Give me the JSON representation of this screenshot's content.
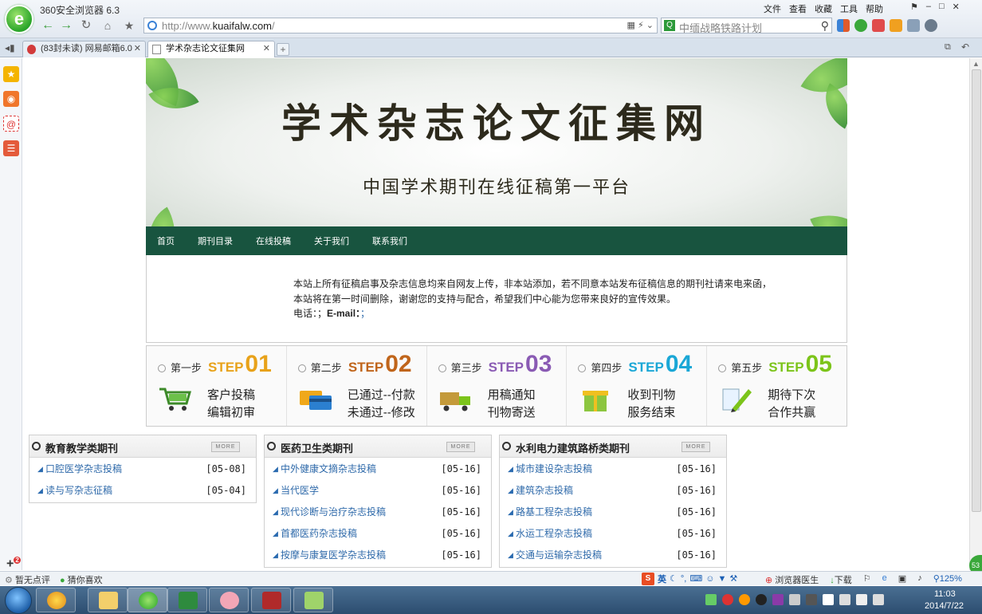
{
  "browser": {
    "title": "360安全浏览器 6.3",
    "url_prefix": "http://www.",
    "url_domain": "kuaifalw.com",
    "url_suffix": "/",
    "search_placeholder": "中缅战略铁路计划",
    "search_engine_icon": "search-engine-icon",
    "menu": [
      "文件",
      "查看",
      "收藏",
      "工具",
      "帮助"
    ],
    "address_tools": "▦ ⚡ ⌄"
  },
  "tabs": [
    {
      "label": "(83封未读) 网易邮箱6.0",
      "icon": "mail-icon",
      "active": false
    },
    {
      "label": "学术杂志论文征集网",
      "icon": "page-icon",
      "active": true
    }
  ],
  "banner": {
    "title": "学术杂志论文征集网",
    "subtitle": "中国学术期刊在线征稿第一平台"
  },
  "nav": [
    "首页",
    "期刊目录",
    "在线投稿",
    "关于我们",
    "联系我们"
  ],
  "notice": {
    "text": "本站上所有征稿启事及杂志信息均来自网友上传，非本站添加，若不同意本站发布征稿信息的期刊社请来电来函，本站将在第一时间删除，谢谢您的支持与配合，希望我们中心能为您带来良好的宣传效果。",
    "phone_label": "电话：；",
    "email_label": "E-mail：",
    "email_value": "；"
  },
  "steps": [
    {
      "label": "第一步",
      "word": "STEP",
      "num": "01",
      "line1": "客户投稿",
      "line2": "编辑初审",
      "color": "#e8a21a",
      "icon": "cart-icon"
    },
    {
      "label": "第二步",
      "word": "STEP",
      "num": "02",
      "line1": "已通过--付款",
      "line2": "未通过--修改",
      "color": "#c0651b",
      "icon": "card-icon"
    },
    {
      "label": "第三步",
      "word": "STEP",
      "num": "03",
      "line1": "用稿通知",
      "line2": "刊物寄送",
      "color": "#8a5bb4",
      "icon": "truck-icon"
    },
    {
      "label": "第四步",
      "word": "STEP",
      "num": "04",
      "line1": "收到刊物",
      "line2": "服务结束",
      "color": "#1aa7d6",
      "icon": "gift-icon"
    },
    {
      "label": "第五步",
      "word": "STEP",
      "num": "05",
      "line1": "期待下次",
      "line2": "合作共赢",
      "color": "#7cc41a",
      "icon": "pen-icon"
    }
  ],
  "boxes": [
    {
      "title": "教育教学类期刊",
      "more": "MORE",
      "items": [
        {
          "title": "口腔医学杂志投稿",
          "date": "[05-08]"
        },
        {
          "title": "读与写杂志征稿",
          "date": "[05-04]"
        }
      ]
    },
    {
      "title": "医药卫生类期刊",
      "more": "MORE",
      "items": [
        {
          "title": "中外健康文摘杂志投稿",
          "date": "[05-16]"
        },
        {
          "title": "当代医学",
          "date": "[05-16]"
        },
        {
          "title": "现代诊断与治疗杂志投稿",
          "date": "[05-16]"
        },
        {
          "title": "首都医药杂志投稿",
          "date": "[05-16]"
        },
        {
          "title": "按摩与康复医学杂志投稿",
          "date": "[05-16]"
        }
      ]
    },
    {
      "title": "水利电力建筑路桥类期刊",
      "more": "MORE",
      "items": [
        {
          "title": "城市建设杂志投稿",
          "date": "[05-16]"
        },
        {
          "title": "建筑杂志投稿",
          "date": "[05-16]"
        },
        {
          "title": "路基工程杂志投稿",
          "date": "[05-16]"
        },
        {
          "title": "水运工程杂志投稿",
          "date": "[05-16]"
        },
        {
          "title": "交通与运输杂志投稿",
          "date": "[05-16]"
        }
      ]
    }
  ],
  "statusbar": {
    "left": [
      "暂无点评",
      "猜你喜欢"
    ],
    "ime_logo": "S",
    "ime_text": "英",
    "right": [
      "浏览器医生",
      "下载"
    ],
    "zoom": "125%"
  },
  "sidebar_badge": "2",
  "floating_badge": "53",
  "clock": {
    "time": "11:03",
    "date": "2014/7/22"
  }
}
